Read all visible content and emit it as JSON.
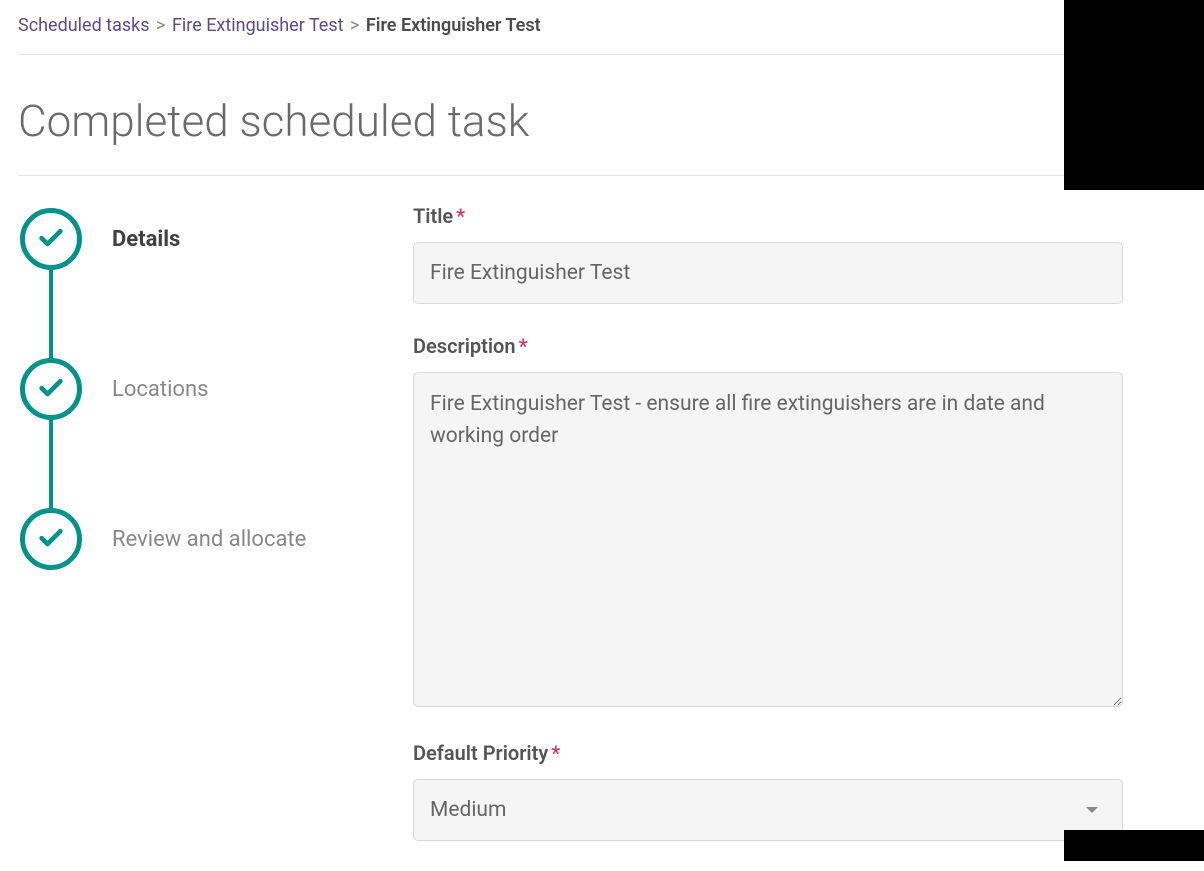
{
  "breadcrumb": {
    "items": [
      {
        "label": "Scheduled tasks",
        "link": true
      },
      {
        "label": "Fire Extinguisher Test",
        "link": true
      },
      {
        "label": "Fire Extinguisher Test",
        "link": false
      }
    ]
  },
  "page_title": "Completed scheduled task",
  "stepper": {
    "steps": [
      {
        "label": "Details",
        "active": true,
        "done": true
      },
      {
        "label": "Locations",
        "active": false,
        "done": true
      },
      {
        "label": "Review and allocate",
        "active": false,
        "done": true
      }
    ]
  },
  "form": {
    "title": {
      "label": "Title",
      "required": "*",
      "value": "Fire Extinguisher Test"
    },
    "description": {
      "label": "Description",
      "required": "*",
      "value": "Fire Extinguisher Test - ensure all fire extinguishers are in date and working order"
    },
    "priority": {
      "label": "Default Priority",
      "required": "*",
      "value": "Medium"
    }
  },
  "colors": {
    "accent": "#00938a",
    "link": "#5a4b8a",
    "required": "#d6336c"
  }
}
